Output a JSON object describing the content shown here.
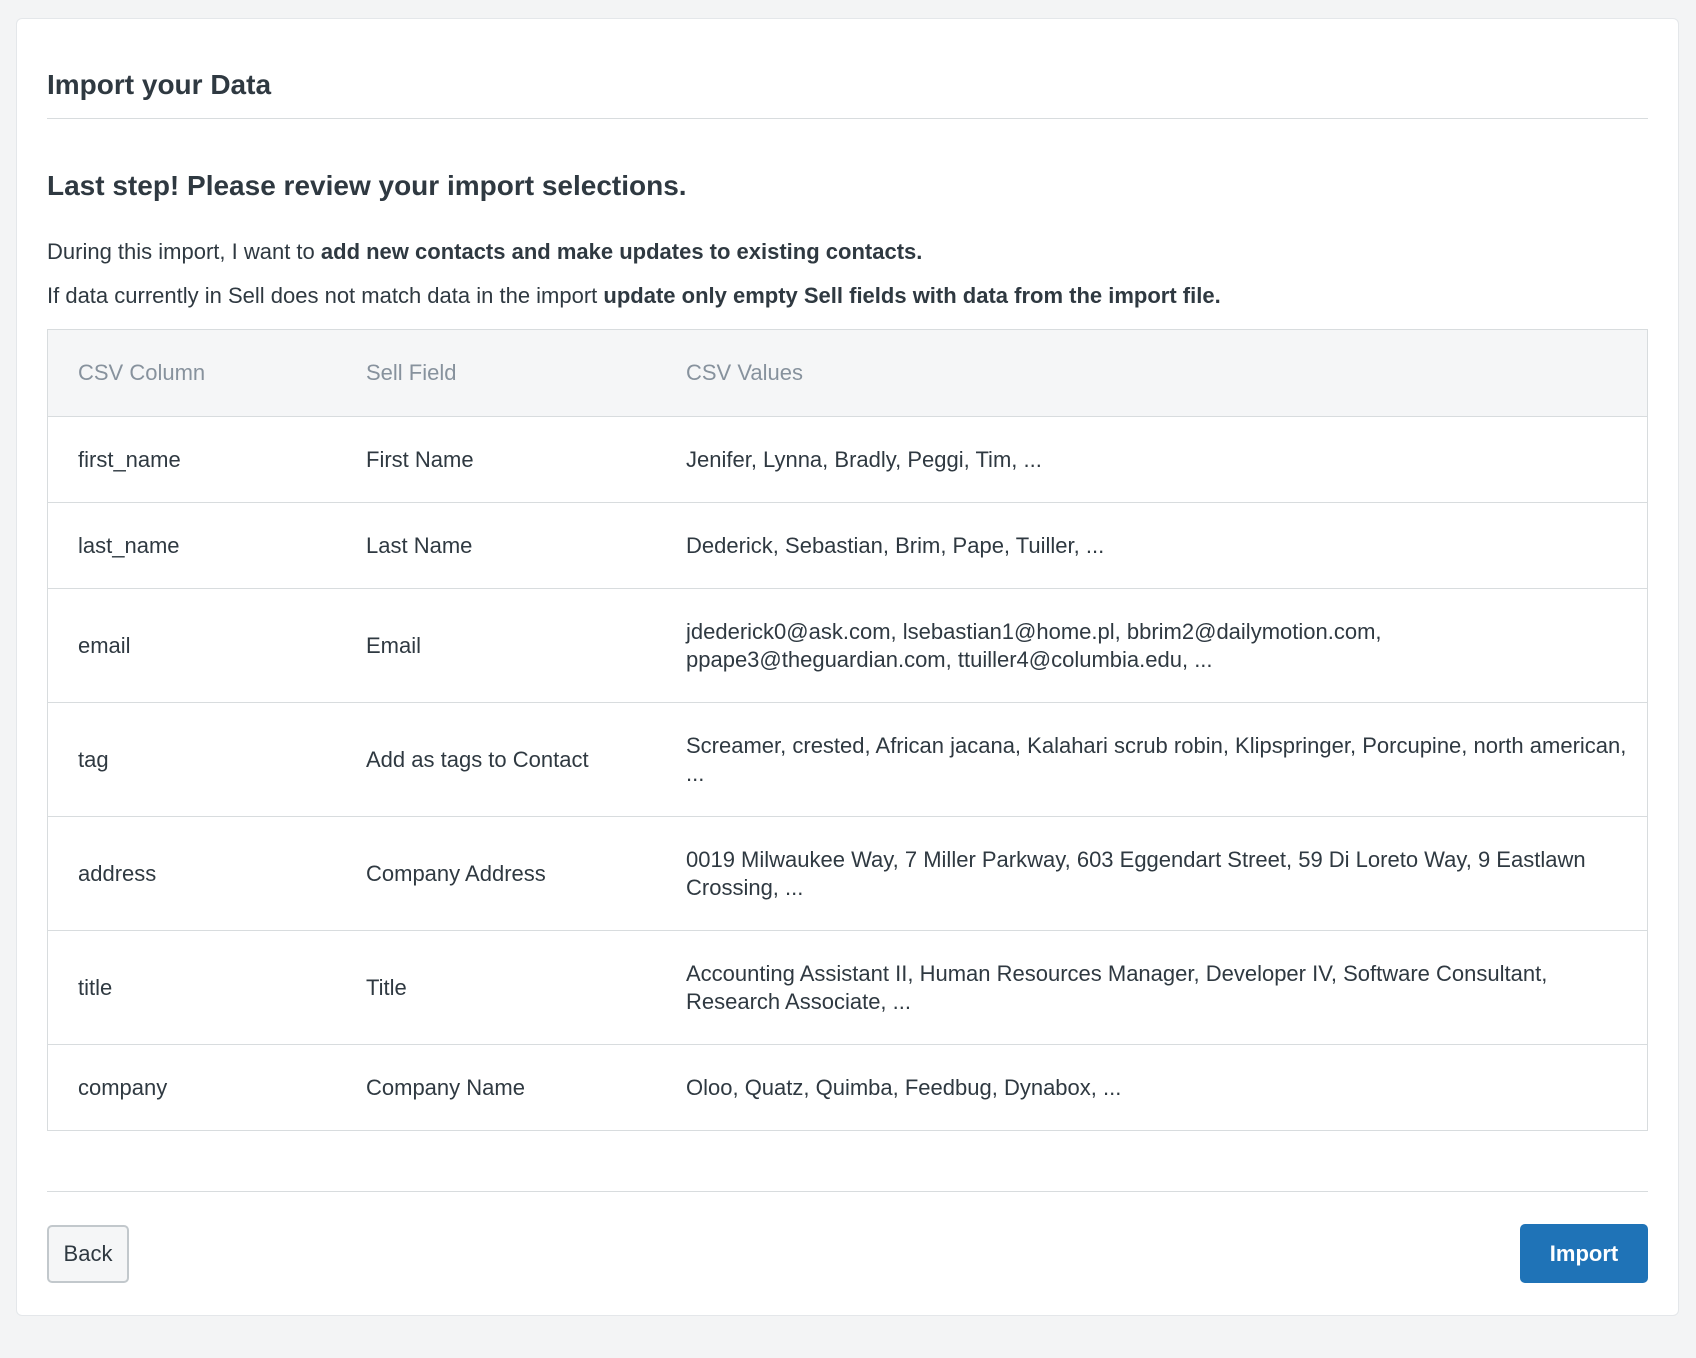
{
  "header": {
    "title": "Import your Data"
  },
  "review": {
    "heading": "Last step! Please review your import selections.",
    "line1_prefix": "During this import, I want to ",
    "line1_bold": "add new contacts and make updates to existing contacts.",
    "line2_prefix": "If data currently in Sell does not match data in the import ",
    "line2_bold": "update only empty Sell fields with data from the import file."
  },
  "table": {
    "columns": [
      "CSV Column",
      "Sell Field",
      "CSV Values"
    ],
    "rows": [
      [
        "first_name",
        "First Name",
        "Jenifer, Lynna, Bradly, Peggi, Tim, ..."
      ],
      [
        "last_name",
        "Last Name",
        "Dederick, Sebastian, Brim, Pape, Tuiller, ..."
      ],
      [
        "email",
        "Email",
        "jdederick0@ask.com, lsebastian1@home.pl, bbrim2@dailymotion.com, ppape3@theguardian.com, ttuiller4@columbia.edu, ..."
      ],
      [
        "tag",
        "Add as tags to Contact",
        "Screamer, crested, African jacana, Kalahari scrub robin, Klipspringer, Porcupine, north american, ..."
      ],
      [
        "address",
        "Company Address",
        "0019 Milwaukee Way, 7 Miller Parkway, 603 Eggendart Street, 59 Di Loreto Way, 9 Eastlawn Crossing, ..."
      ],
      [
        "title",
        "Title",
        "Accounting Assistant II, Human Resources Manager, Developer IV, Software Consultant, Research Associate, ..."
      ],
      [
        "company",
        "Company Name",
        "Oloo, Quatz, Quimba, Feedbug, Dynabox, ..."
      ]
    ]
  },
  "footer": {
    "back_label": "Back",
    "import_label": "Import"
  },
  "colors": {
    "primary": "#1f73b7",
    "text": "#2f3941",
    "muted": "#87929d",
    "border": "#d8dcde"
  }
}
